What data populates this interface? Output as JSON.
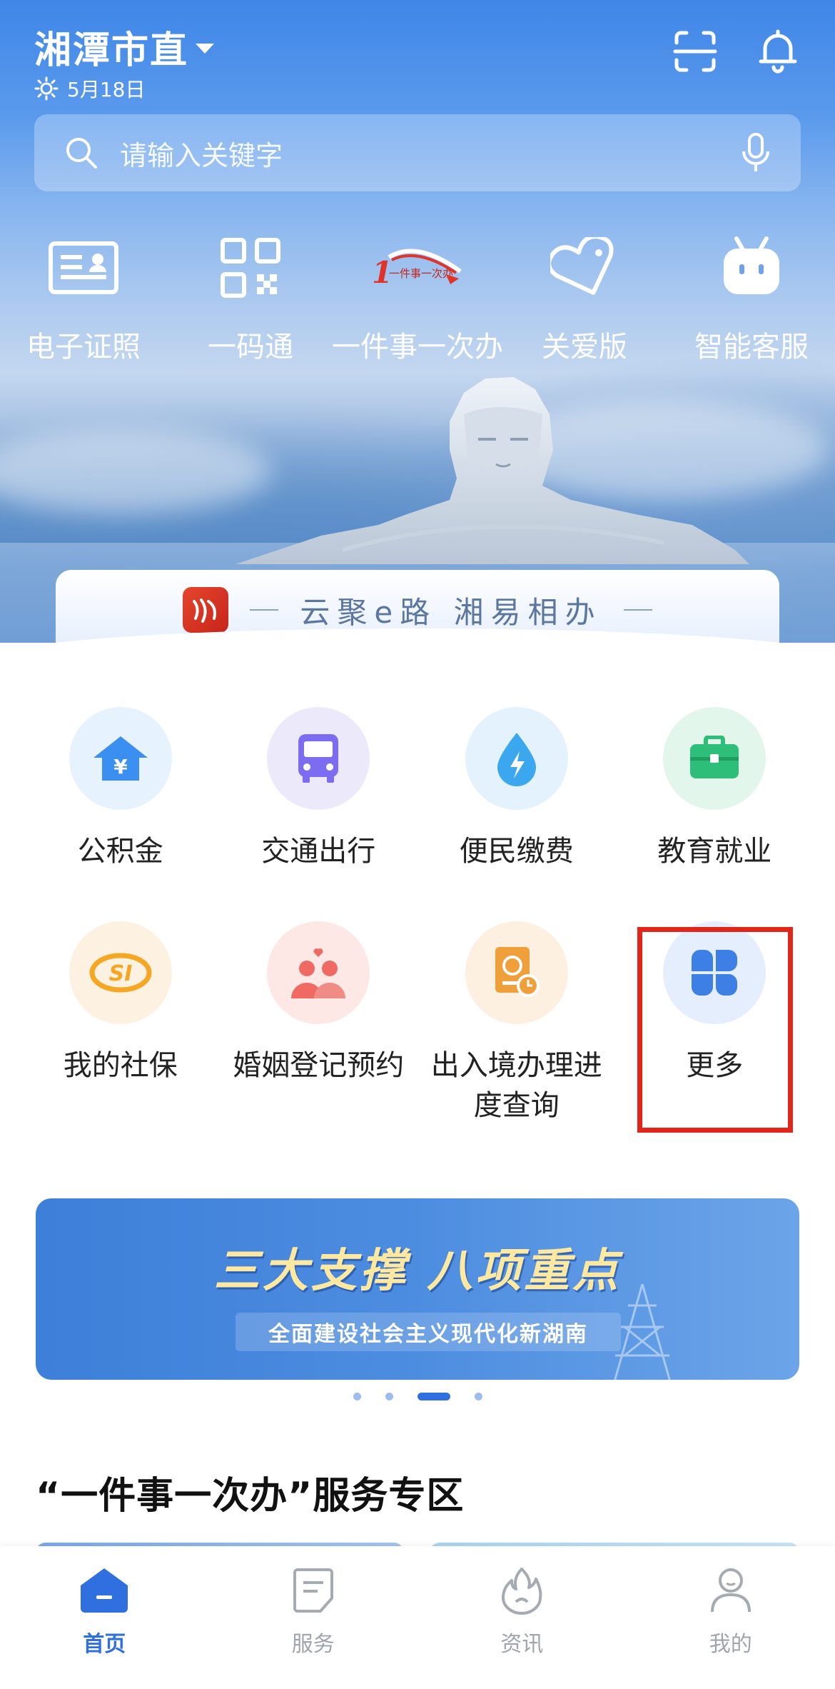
{
  "header": {
    "city": "湘潭市直",
    "date": "5月18日"
  },
  "search": {
    "placeholder": "请输入关键字"
  },
  "quick_actions": [
    {
      "label": "电子证照",
      "icon": "id-card-icon"
    },
    {
      "label": "一码通",
      "icon": "qr-code-icon"
    },
    {
      "label": "一件事一次办",
      "icon": "one-thing-logo-icon",
      "logo_text": "一件事一次办"
    },
    {
      "label": "关爱版",
      "icon": "heart-tag-icon"
    },
    {
      "label": "智能客服",
      "icon": "robot-icon"
    }
  ],
  "slogan": {
    "text": "云聚e路 湘易相办"
  },
  "services": [
    {
      "label": "公积金",
      "icon": "housing-fund-icon",
      "color": "#3b8ff0"
    },
    {
      "label": "交通出行",
      "icon": "bus-icon",
      "color": "#7b6cf0"
    },
    {
      "label": "便民缴费",
      "icon": "electricity-drop-icon",
      "color": "#3ba7ef"
    },
    {
      "label": "教育就业",
      "icon": "briefcase-icon",
      "color": "#2dbf7a"
    },
    {
      "label": "我的社保",
      "icon": "social-security-icon",
      "color": "#f5a623"
    },
    {
      "label": "婚姻登记预约",
      "icon": "couple-heart-icon",
      "color": "#ef6a63"
    },
    {
      "label": "出入境办理进度查询",
      "icon": "passport-clock-icon",
      "color": "#f0a03a"
    },
    {
      "label": "更多",
      "icon": "more-grid-icon",
      "color": "#3d7fe5"
    }
  ],
  "banner": {
    "title": "三大支撑 八项重点",
    "subtitle": "全面建设社会主义现代化新湖南",
    "page_count": 4,
    "active_index": 2
  },
  "section": {
    "title": "“一件事一次办”服务专区"
  },
  "tabs": [
    {
      "label": "首页",
      "active": true,
      "icon": "home-icon"
    },
    {
      "label": "服务",
      "active": false,
      "icon": "service-doc-icon"
    },
    {
      "label": "资讯",
      "active": false,
      "icon": "flame-icon"
    },
    {
      "label": "我的",
      "active": false,
      "icon": "user-icon"
    }
  ],
  "colors": {
    "accent": "#2f6fe0",
    "highlight_box": "#e1251b"
  }
}
